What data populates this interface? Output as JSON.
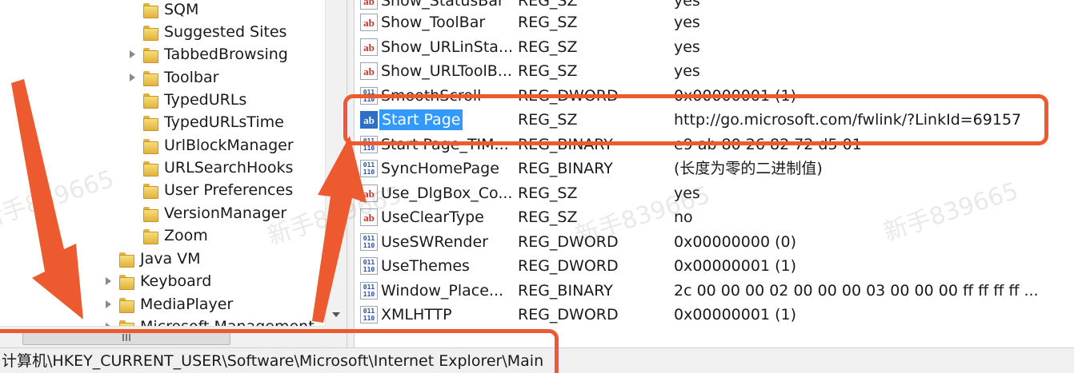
{
  "tree": {
    "items": [
      {
        "label": "SQM",
        "expandable": false
      },
      {
        "label": "Suggested Sites",
        "expandable": false
      },
      {
        "label": "TabbedBrowsing",
        "expandable": true
      },
      {
        "label": "Toolbar",
        "expandable": true
      },
      {
        "label": "TypedURLs",
        "expandable": false
      },
      {
        "label": "TypedURLsTime",
        "expandable": false
      },
      {
        "label": "UrlBlockManager",
        "expandable": false
      },
      {
        "label": "URLSearchHooks",
        "expandable": false
      },
      {
        "label": "User Preferences",
        "expandable": false
      },
      {
        "label": "VersionManager",
        "expandable": false
      },
      {
        "label": "Zoom",
        "expandable": false
      },
      {
        "label": "Java VM",
        "expandable": false
      },
      {
        "label": "Keyboard",
        "expandable": true
      },
      {
        "label": "MediaPlayer",
        "expandable": true
      },
      {
        "label": "Microsoft Management",
        "expandable": true
      }
    ]
  },
  "values": {
    "rows": [
      {
        "name": "Show_StatusBar",
        "type": "REG_SZ",
        "data": "yes",
        "icon": "reg-sz-icon"
      },
      {
        "name": "Show_ToolBar",
        "type": "REG_SZ",
        "data": "yes",
        "icon": "reg-sz-icon"
      },
      {
        "name": "Show_URLinSta...",
        "type": "REG_SZ",
        "data": "yes",
        "icon": "reg-sz-icon"
      },
      {
        "name": "Show_URLToolB...",
        "type": "REG_SZ",
        "data": "yes",
        "icon": "reg-sz-icon"
      },
      {
        "name": "SmoothScroll",
        "type": "REG_DWORD",
        "data": "0x00000001 (1)",
        "icon": "reg-binary-icon"
      },
      {
        "name": "Start Page",
        "type": "REG_SZ",
        "data": "http://go.microsoft.com/fwlink/?LinkId=69157",
        "icon": "reg-sz-icon",
        "selected": true
      },
      {
        "name": "Start Page_TIM...",
        "type": "REG_BINARY",
        "data": "e9 ab 80 26 82 72 d5 01",
        "icon": "reg-binary-icon"
      },
      {
        "name": "SyncHomePage",
        "type": "REG_BINARY",
        "data": "(长度为零的二进制值)",
        "icon": "reg-binary-icon"
      },
      {
        "name": "Use_DlgBox_Co...",
        "type": "REG_SZ",
        "data": "yes",
        "icon": "reg-sz-icon"
      },
      {
        "name": "UseClearType",
        "type": "REG_SZ",
        "data": "no",
        "icon": "reg-sz-icon"
      },
      {
        "name": "UseSWRender",
        "type": "REG_DWORD",
        "data": "0x00000000 (0)",
        "icon": "reg-binary-icon"
      },
      {
        "name": "UseThemes",
        "type": "REG_DWORD",
        "data": "0x00000001 (1)",
        "icon": "reg-binary-icon"
      },
      {
        "name": "Window_Place...",
        "type": "REG_BINARY",
        "data": "2c 00 00 00 02 00 00 00 03 00 00 00 ff ff ff ff ...",
        "icon": "reg-binary-icon"
      },
      {
        "name": "XMLHTTP",
        "type": "REG_DWORD",
        "data": "0x00000001 (1)",
        "icon": "reg-binary-icon"
      }
    ]
  },
  "status_bar": {
    "path": "计算机\\HKEY_CURRENT_USER\\Software\\Microsoft\\Internet Explorer\\Main"
  },
  "watermark": {
    "text": "新手839665"
  },
  "colors": {
    "selection": "#3399ff",
    "annotation": "#ee5a2f"
  }
}
